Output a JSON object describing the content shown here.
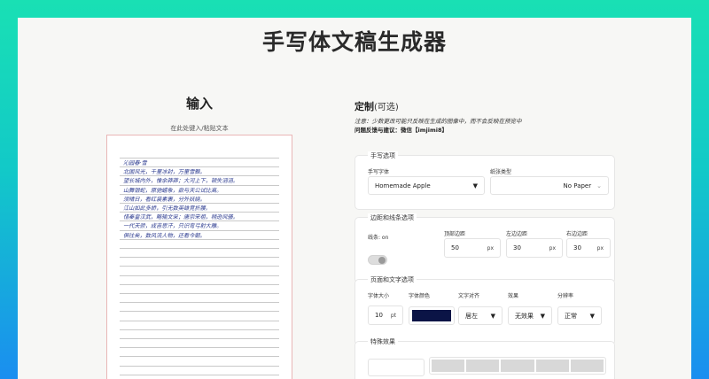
{
  "app": {
    "title": "手写体文稿生成器"
  },
  "input": {
    "heading": "输入",
    "hint": "在此处键入/粘贴文本",
    "lines": [
      "沁园春·雪",
      "北国风光，千里冰封，万里雪飘。",
      "望长城内外，惟余莽莽；大河上下，顿失滔滔。",
      "山舞银蛇，原驰蜡象，欲与天公试比高。",
      "须晴日，看红装素裹，分外妖娆。",
      "江山如此多娇，引无数英雄竞折腰。",
      "惜秦皇汉武，略输文采；唐宗宋祖，稍逊风骚。",
      "一代天骄，成吉思汗，只识弯弓射大雕。",
      "俱往矣，数风流人物，还看今朝。"
    ],
    "ink_color": "#2b3a8f"
  },
  "settings": {
    "heading": "定制",
    "heading_optional": "(可选)",
    "note": "注意：少数更改可能只反映在生成的图像中，而不会反映在预览中",
    "feedback": "问题反馈与建议：微信【imjimi8】",
    "handwriting": {
      "title": "手写选项",
      "font_label": "手写字体",
      "font_value": "Homemade Apple",
      "paper_label": "纸张类型",
      "paper_value": "No Paper"
    },
    "margins": {
      "title": "边距和线条选项",
      "lines_label": "线条: on",
      "top_label": "顶部边距",
      "top_value": "50",
      "left_label": "左边边距",
      "left_value": "30",
      "right_label": "右边边距",
      "right_value": "30",
      "unit": "px"
    },
    "page_text": {
      "title": "页面和文字选项",
      "size_label": "字体大小",
      "size_value": "10",
      "size_unit": "pt",
      "color_label": "字体颜色",
      "color_value": "#0b1446",
      "align_label": "文字对齐",
      "align_value": "居左",
      "effect_label": "效果",
      "effect_value": "无效果",
      "resolution_label": "分辨率",
      "resolution_value": "正常"
    },
    "special": {
      "title": "特殊效果"
    }
  }
}
